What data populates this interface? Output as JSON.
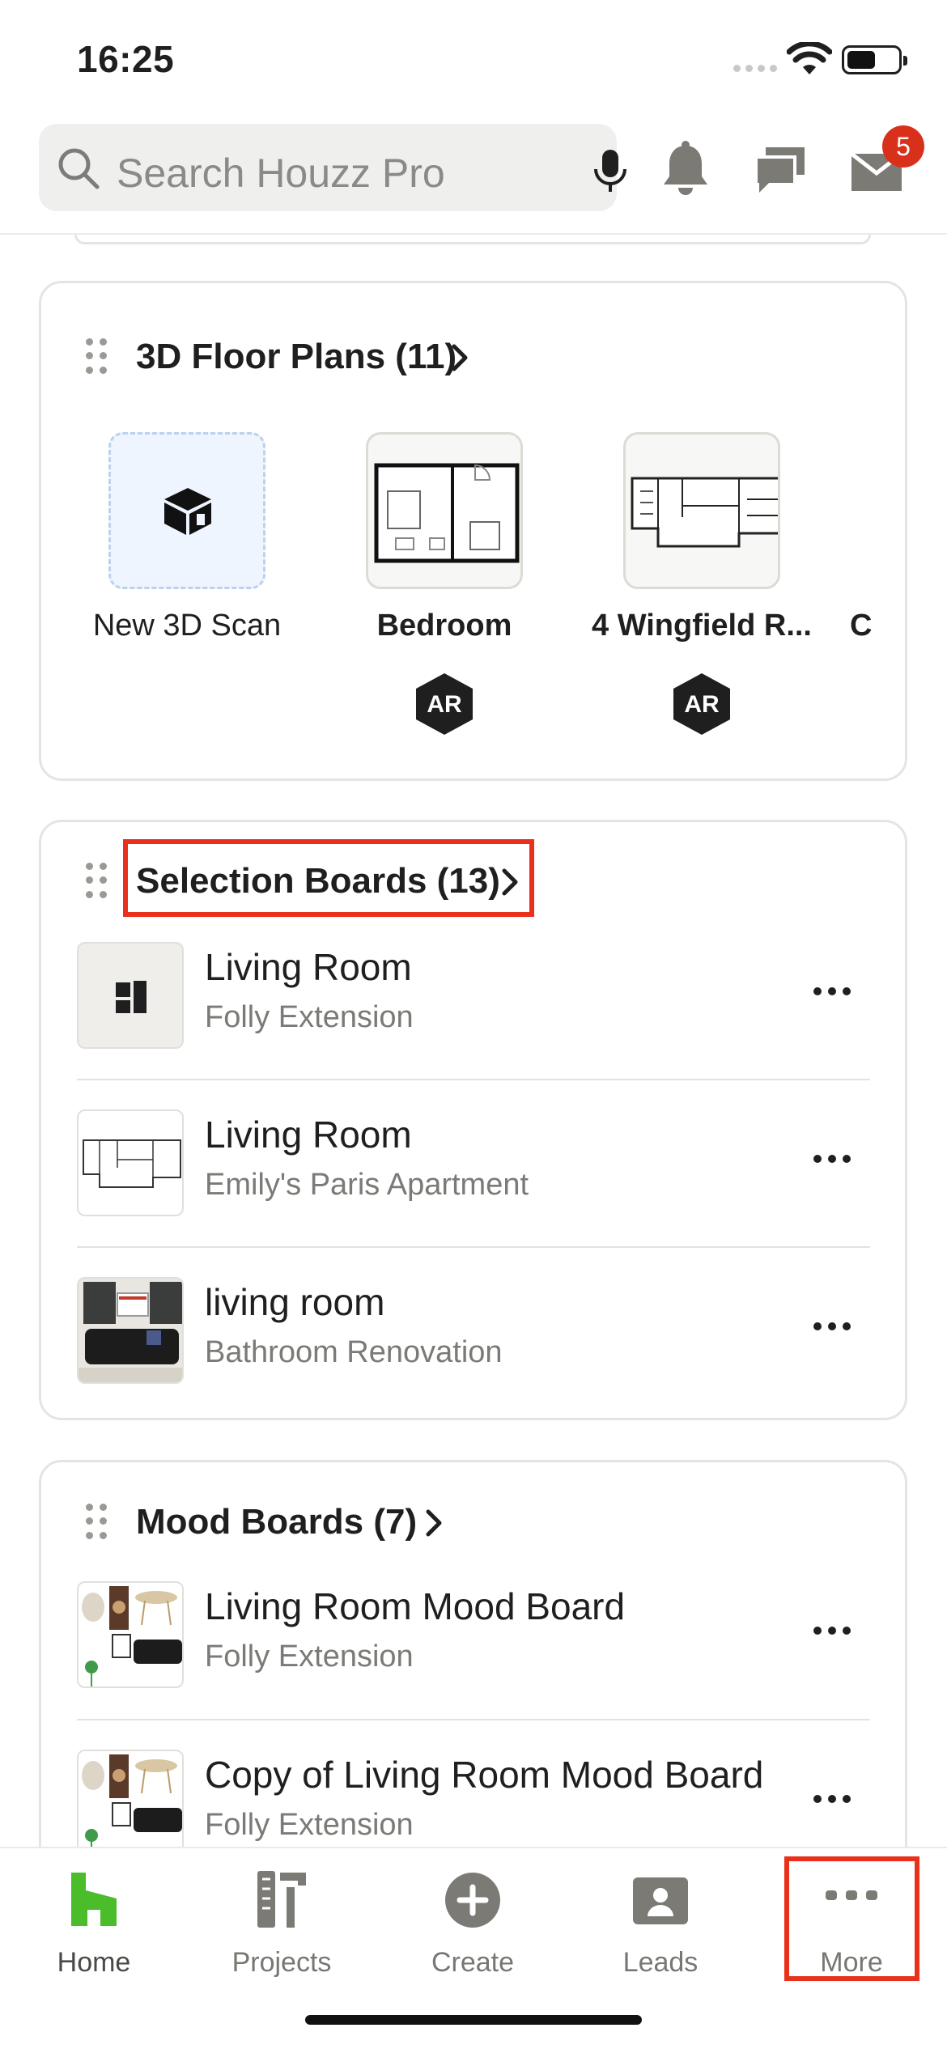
{
  "status_bar": {
    "time": "16:25"
  },
  "search": {
    "placeholder": "Search Houzz Pro"
  },
  "header": {
    "notification_badge": "5"
  },
  "floor_plans": {
    "title": "3D Floor Plans (11)",
    "items": [
      {
        "label": "New 3D Scan",
        "ar": false
      },
      {
        "label": "Bedroom",
        "ar": true,
        "ar_label": "AR"
      },
      {
        "label": "4 Wingfield R...",
        "ar": true,
        "ar_label": "AR"
      },
      {
        "label": "C"
      }
    ]
  },
  "selection_boards": {
    "title": "Selection Boards (13)",
    "items": [
      {
        "title": "Living Room",
        "subtitle": "Folly Extension"
      },
      {
        "title": "Living Room",
        "subtitle": "Emily's Paris Apartment"
      },
      {
        "title": "living room",
        "subtitle": "Bathroom Renovation"
      }
    ]
  },
  "mood_boards": {
    "title": "Mood Boards (7)",
    "items": [
      {
        "title": "Living Room Mood Board",
        "subtitle": "Folly Extension"
      },
      {
        "title": "Copy of Living Room Mood Board",
        "subtitle": "Folly Extension"
      }
    ]
  },
  "tabbar": {
    "tabs": [
      {
        "label": "Home",
        "icon": "houzz-home-icon"
      },
      {
        "label": "Projects",
        "icon": "projects-icon"
      },
      {
        "label": "Create",
        "icon": "plus-circle-icon"
      },
      {
        "label": "Leads",
        "icon": "leads-icon"
      },
      {
        "label": "More",
        "icon": "more-dots-icon"
      }
    ]
  },
  "colors": {
    "brand_green": "#4bbc2a",
    "highlight": "#e8301a",
    "badge_red": "#d9301c"
  }
}
